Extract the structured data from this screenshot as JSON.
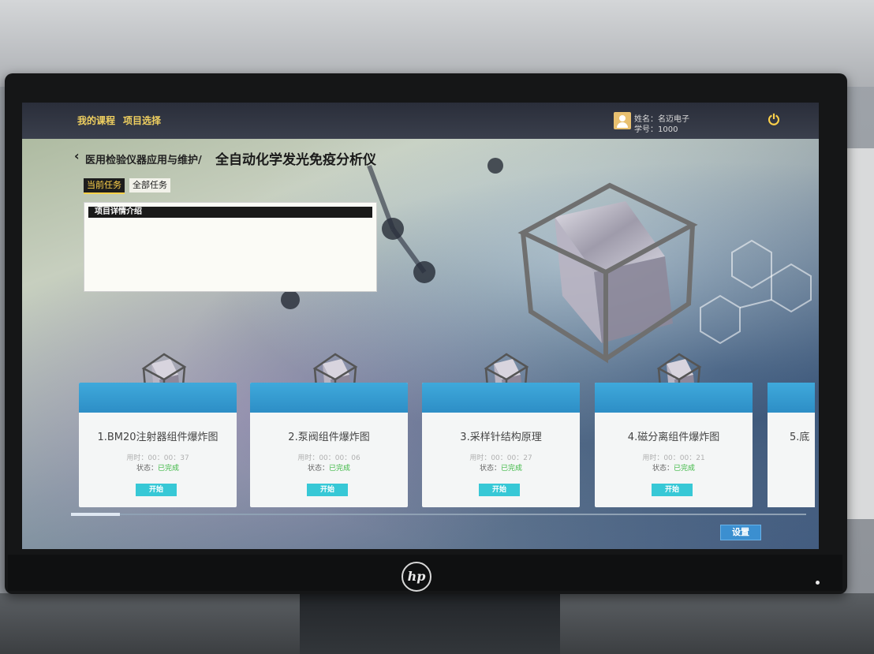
{
  "topbar": {
    "my_course": "我的课程",
    "project_select": "项目选择",
    "user_name": "姓名：名迈电子",
    "user_id": "学号：1000"
  },
  "breadcrumb": {
    "course": "医用检验仪器应用与维护/",
    "project": "全自动化学发光免疫分析仪"
  },
  "tabs": {
    "current": "当前任务",
    "all": "全部任务"
  },
  "detail": {
    "title": "项目详情介绍"
  },
  "tasks": [
    {
      "title": "1.BM20注射器组件爆炸图",
      "time": "用时：00：00：37",
      "status_label": "状态：",
      "status": "已完成",
      "button": "开始"
    },
    {
      "title": "2.泵阀组件爆炸图",
      "time": "用时：00：00：06",
      "status_label": "状态：",
      "status": "已完成",
      "button": "开始"
    },
    {
      "title": "3.采样针结构原理",
      "time": "用时：00：00：27",
      "status_label": "状态：",
      "status": "已完成",
      "button": "开始"
    },
    {
      "title": "4.磁分离组件爆炸图",
      "time": "用时：00：00：21",
      "status_label": "状态：",
      "status": "已完成",
      "button": "开始"
    }
  ],
  "partial_task": {
    "title": "5.底"
  },
  "settings_label": "设置",
  "hp_logo": "hp",
  "colors": {
    "accent_yellow": "#ffd24a",
    "card_header": "#3fa9db",
    "status_done": "#3cb843",
    "start_button": "#37c8d6"
  }
}
